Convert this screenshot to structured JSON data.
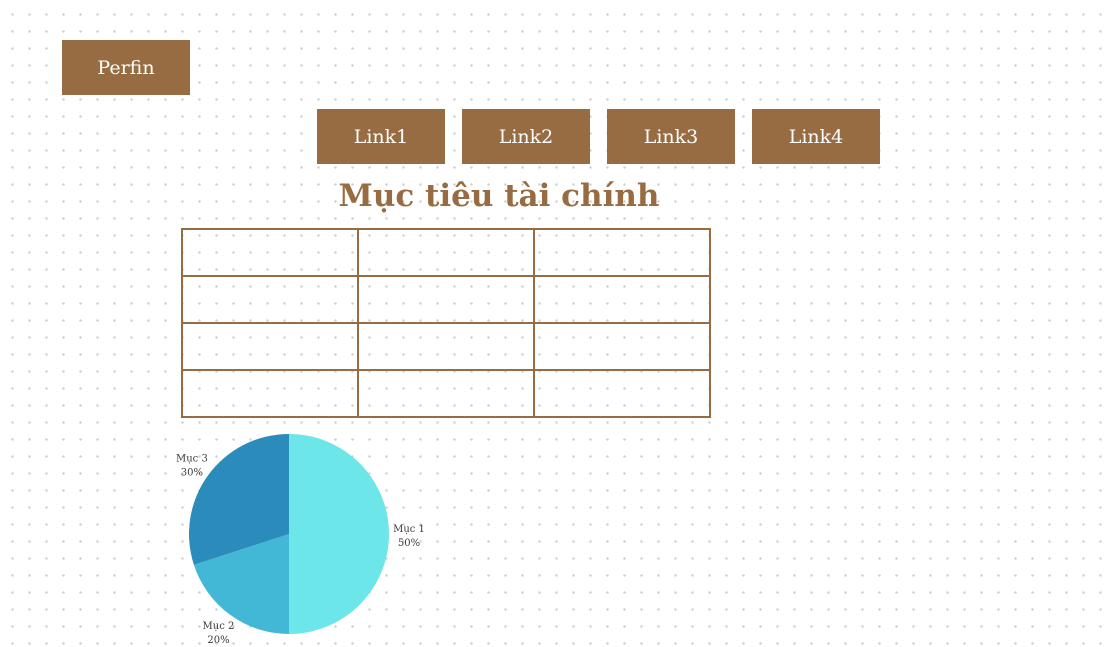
{
  "brand": {
    "label": "Perfin"
  },
  "nav": {
    "links": [
      {
        "label": "Link1"
      },
      {
        "label": "Link2"
      },
      {
        "label": "Link3"
      },
      {
        "label": "Link4"
      }
    ]
  },
  "page": {
    "title": "Mục tiêu tài chính"
  },
  "table": {
    "rows": [
      [
        "",
        "",
        ""
      ],
      [
        "",
        "",
        ""
      ],
      [
        "",
        "",
        ""
      ],
      [
        "",
        "",
        ""
      ]
    ]
  },
  "colors": {
    "accent": "#986c42",
    "slice_1": "#6ce6e8",
    "slice_2": "#42b8d6",
    "slice_3": "#2b8cbc"
  },
  "chart_data": {
    "type": "pie",
    "categories": [
      "Mục 1",
      "Mục 2",
      "Mục 3"
    ],
    "values": [
      50,
      20,
      30
    ],
    "labels": [
      "50%",
      "20%",
      "30%"
    ],
    "colors": [
      "#6ce6e8",
      "#42b8d6",
      "#2b8cbc"
    ],
    "start": "top",
    "direction": "clockwise"
  }
}
